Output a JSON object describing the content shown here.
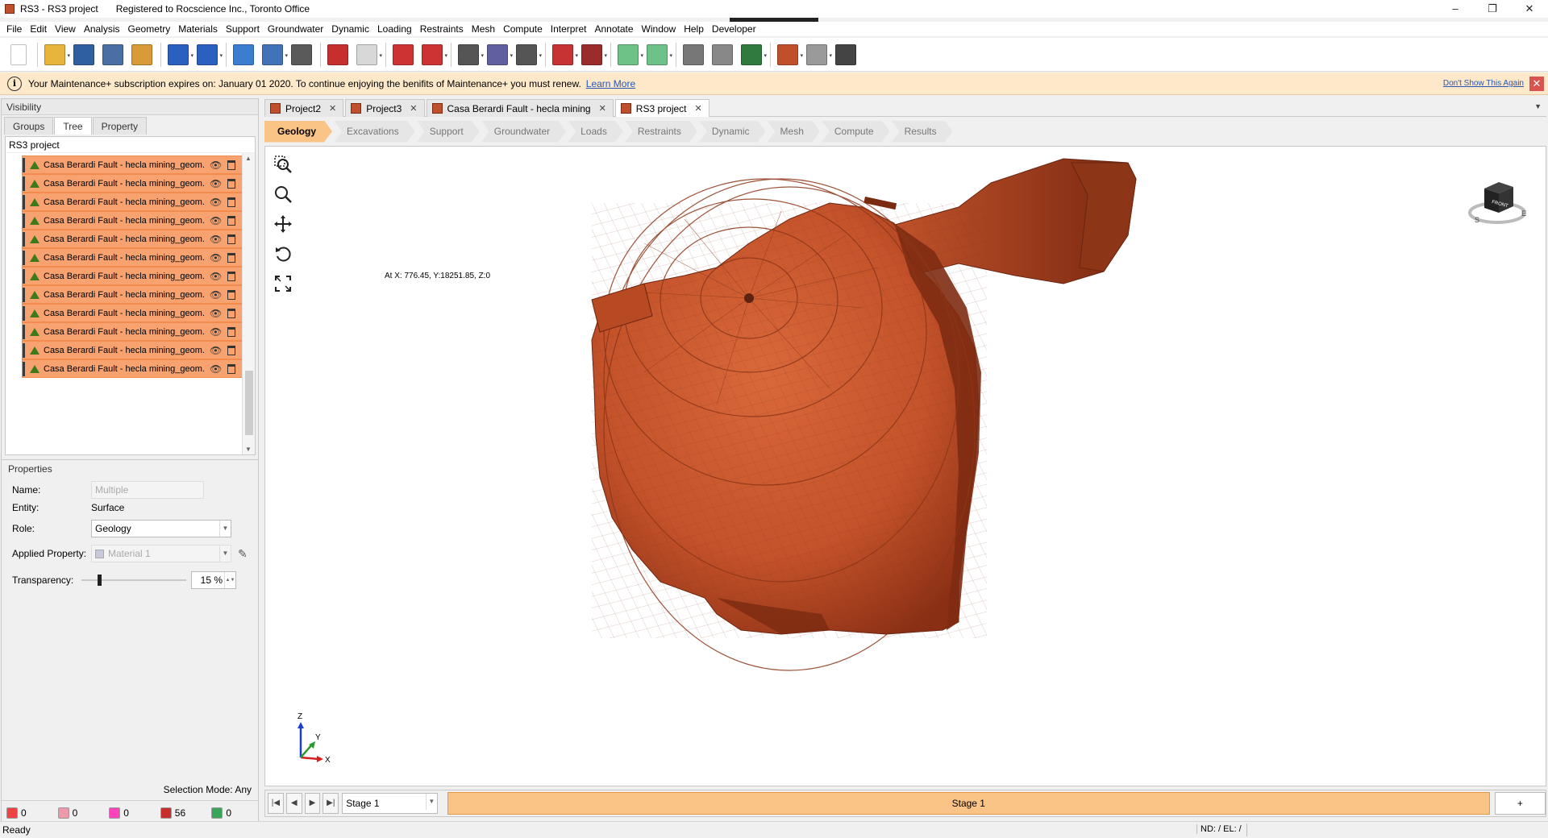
{
  "window": {
    "title": "RS3 - RS3 project",
    "registration": "Registered to Rocscience Inc., Toronto Office",
    "controls": [
      "–",
      "❐",
      "✕"
    ]
  },
  "menu": [
    "File",
    "Edit",
    "View",
    "Analysis",
    "Geometry",
    "Materials",
    "Support",
    "Groundwater",
    "Dynamic",
    "Loading",
    "Restraints",
    "Mesh",
    "Compute",
    "Interpret",
    "Annotate",
    "Window",
    "Help",
    "Developer"
  ],
  "toolbar": {
    "icons": [
      "new-file-icon",
      "open-folder-icon",
      "save-icon",
      "print-icon",
      "export-icon",
      "undo-icon",
      "redo-icon",
      "grid-view-icon",
      "image-icon",
      "wand-icon",
      "red-block-icon",
      "box-icon",
      "selection-lock-icon",
      "selection-clear-icon",
      "pen-icon",
      "shapes-icon",
      "import-icon",
      "cube-red-icon",
      "section-icon",
      "sphere-green-icon",
      "sphere-green2-icon",
      "layers-icon",
      "chart-icon",
      "eye-icon",
      "cube-multicolor-icon",
      "boxes-icon",
      "magnet-icon"
    ],
    "colors": [
      "#ffffff",
      "#e7b53c",
      "#2f5f9e",
      "#4a6fa5",
      "#d89b38",
      "#2a60c0",
      "#2a60c0",
      "#3b7ed0",
      "#4273b8",
      "#5a5a5a",
      "#c72e2e",
      "#d8d8d8",
      "#cc3333",
      "#cc3333",
      "#555555",
      "#6060a0",
      "#555555",
      "#c73232",
      "#9b2c2c",
      "#6fc287",
      "#6fc287",
      "#777777",
      "#888888",
      "#2f7a3f",
      "#c0502b",
      "#9a9a9a",
      "#444444"
    ]
  },
  "notice": {
    "message": "Your Maintenance+ subscription expires on: January 01 2020. To continue enjoying the benifits of Maintenance+ you must renew.",
    "link": "Learn More",
    "dont_show": "Don't Show This Again",
    "close": "✕",
    "info": "i"
  },
  "left_panel": {
    "visibility_title": "Visibility",
    "tabs": [
      "Groups",
      "Tree",
      "Property"
    ],
    "active_tab": "Tree",
    "tree_root": "RS3 project",
    "tree_items": [
      "Casa Berardi Fault - hecla mining_geom.D",
      "Casa Berardi Fault - hecla mining_geom.D",
      "Casa Berardi Fault - hecla mining_geom.D",
      "Casa Berardi Fault - hecla mining_geom.D",
      "Casa Berardi Fault - hecla mining_geom.D",
      "Casa Berardi Fault - hecla mining_geom.D",
      "Casa Berardi Fault - hecla mining_geom.D",
      "Casa Berardi Fault - hecla mining_geom.D",
      "Casa Berardi Fault - hecla mining_geom.D",
      "Casa Berardi Fault - hecla mining_geom.D",
      "Casa Berardi Fault - hecla mining_geom.D",
      "Casa Berardi Fault - hecla mining_geom.D"
    ],
    "properties_title": "Properties",
    "props": {
      "name_label": "Name:",
      "name_placeholder": "Multiple",
      "entity_label": "Entity:",
      "entity_value": "Surface",
      "role_label": "Role:",
      "role_value": "Geology",
      "applied_label": "Applied Property:",
      "applied_value": "Material 1",
      "transparency_label": "Transparency:",
      "transparency_value": "15 %"
    },
    "selection_mode": "Selection Mode: Any",
    "counts": [
      {
        "icon": "vertex-count-icon",
        "value": "0",
        "color": "#e44"
      },
      {
        "icon": "edge-count-icon",
        "value": "0",
        "color": "#e9a"
      },
      {
        "icon": "face-count-icon",
        "value": "0",
        "color": "#f4b"
      },
      {
        "icon": "volume-count-icon",
        "value": "56",
        "color": "#c72e2e"
      },
      {
        "icon": "support-count-icon",
        "value": "0",
        "color": "#3aa55a"
      }
    ]
  },
  "doc_tabs": [
    {
      "label": "Project2",
      "active": false
    },
    {
      "label": "Project3",
      "active": false
    },
    {
      "label": "Casa Berardi Fault - hecla mining",
      "active": false
    },
    {
      "label": "RS3 project",
      "active": true
    }
  ],
  "workflow_tabs": [
    "Geology",
    "Excavations",
    "Support",
    "Groundwater",
    "Loads",
    "Restraints",
    "Dynamic",
    "Mesh",
    "Compute",
    "Results"
  ],
  "workflow_active": "Geology",
  "viewport": {
    "coord": "At X: 776.45, Y:18251.85, Z:0",
    "axes": {
      "x": "X",
      "y": "Y",
      "z": "Z"
    },
    "navcube": {
      "face": "FRONT",
      "side": "S",
      "right": "E"
    },
    "model_color": "#c8532a"
  },
  "stage": {
    "selected": "Stage 1",
    "current": "Stage 1",
    "add": "+"
  },
  "status": {
    "left": "Ready",
    "right": "ND: /  EL: /"
  }
}
